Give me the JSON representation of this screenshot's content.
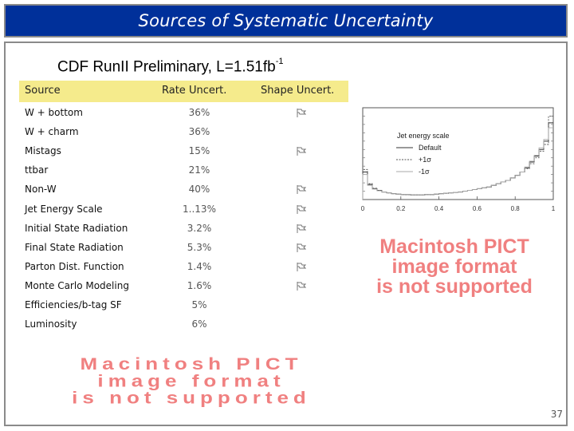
{
  "slide": {
    "title": "Sources of Systematic Uncertainty",
    "subtitle": "CDF RunII Preliminary, L=1.51fb",
    "subtitle_sup": "-1",
    "page_number": "37"
  },
  "table": {
    "headers": {
      "source": "Source",
      "rate": "Rate Uncert.",
      "shape": "Shape Uncert."
    },
    "rows": [
      {
        "source": "W + bottom",
        "rate": "36%",
        "shape": true
      },
      {
        "source": "W + charm",
        "rate": "36%",
        "shape": false
      },
      {
        "source": "Mistags",
        "rate": "15%",
        "shape": true
      },
      {
        "source": "ttbar",
        "rate": "21%",
        "shape": false
      },
      {
        "source": "Non-W",
        "rate": "40%",
        "shape": true
      },
      {
        "source": "Jet Energy Scale",
        "rate": "1..13%",
        "shape": true
      },
      {
        "source": "Initial State Radiation",
        "rate": "3.2%",
        "shape": true
      },
      {
        "source": "Final State Radiation",
        "rate": "5.3%",
        "shape": true
      },
      {
        "source": "Parton Dist. Function",
        "rate": "1.4%",
        "shape": true
      },
      {
        "source": "Monte Carlo Modeling",
        "rate": "1.6%",
        "shape": true
      },
      {
        "source": "Efficiencies/b-tag SF",
        "rate": "5%",
        "shape": false
      },
      {
        "source": "Luminosity",
        "rate": "6%",
        "shape": false
      }
    ],
    "shape_icon": "flag-icon"
  },
  "placeholders": {
    "pict_line1": "Macintosh PICT",
    "pict_line2": "image format",
    "pict_line3": "is not supported"
  },
  "colors": {
    "title_bg": "#00309a",
    "header_row_bg": "#f5eb8c",
    "pict_text": "#f08080",
    "frame_border": "#8a8a8a"
  },
  "chart_data": {
    "type": "line",
    "title": "",
    "legend_title": "Jet energy scale",
    "legend": [
      "Default",
      "+1σ",
      "-1σ"
    ],
    "legend_placement": "center-left",
    "xlabel": "",
    "ylabel": "",
    "xlim": [
      0,
      1
    ],
    "x_ticks": [
      "0",
      "0.2",
      "0.4",
      "0.6",
      "0.8",
      "1"
    ],
    "x": [
      0.0,
      0.025,
      0.05,
      0.075,
      0.1,
      0.125,
      0.15,
      0.175,
      0.2,
      0.225,
      0.25,
      0.275,
      0.3,
      0.325,
      0.35,
      0.375,
      0.4,
      0.425,
      0.45,
      0.475,
      0.5,
      0.525,
      0.55,
      0.575,
      0.6,
      0.625,
      0.65,
      0.675,
      0.7,
      0.725,
      0.75,
      0.775,
      0.8,
      0.825,
      0.85,
      0.875,
      0.9,
      0.925,
      0.95,
      0.975
    ],
    "series": [
      {
        "name": "Default",
        "style": "solid",
        "values": [
          0.33,
          0.18,
          0.13,
          0.11,
          0.09,
          0.08,
          0.07,
          0.065,
          0.06,
          0.06,
          0.055,
          0.055,
          0.055,
          0.06,
          0.06,
          0.065,
          0.07,
          0.075,
          0.08,
          0.085,
          0.09,
          0.1,
          0.11,
          0.12,
          0.13,
          0.14,
          0.15,
          0.17,
          0.19,
          0.21,
          0.23,
          0.26,
          0.29,
          0.33,
          0.38,
          0.45,
          0.52,
          0.6,
          0.7,
          0.92
        ]
      },
      {
        "name": "+1σ",
        "style": "dashed",
        "values": [
          0.36,
          0.19,
          0.135,
          0.11,
          0.09,
          0.08,
          0.07,
          0.065,
          0.06,
          0.058,
          0.055,
          0.055,
          0.056,
          0.06,
          0.06,
          0.065,
          0.07,
          0.074,
          0.08,
          0.085,
          0.09,
          0.1,
          0.11,
          0.12,
          0.13,
          0.14,
          0.15,
          0.17,
          0.19,
          0.21,
          0.23,
          0.26,
          0.29,
          0.33,
          0.37,
          0.43,
          0.5,
          0.58,
          0.66,
          1.0
        ]
      },
      {
        "name": "-1σ",
        "style": "dotted",
        "values": [
          0.3,
          0.17,
          0.125,
          0.105,
          0.09,
          0.08,
          0.07,
          0.065,
          0.06,
          0.06,
          0.056,
          0.056,
          0.057,
          0.06,
          0.062,
          0.066,
          0.07,
          0.076,
          0.08,
          0.086,
          0.092,
          0.1,
          0.11,
          0.12,
          0.13,
          0.14,
          0.15,
          0.17,
          0.19,
          0.21,
          0.23,
          0.26,
          0.29,
          0.33,
          0.39,
          0.46,
          0.53,
          0.62,
          0.72,
          0.86
        ]
      }
    ],
    "ylim": [
      0,
      1.1
    ],
    "grid": false
  }
}
